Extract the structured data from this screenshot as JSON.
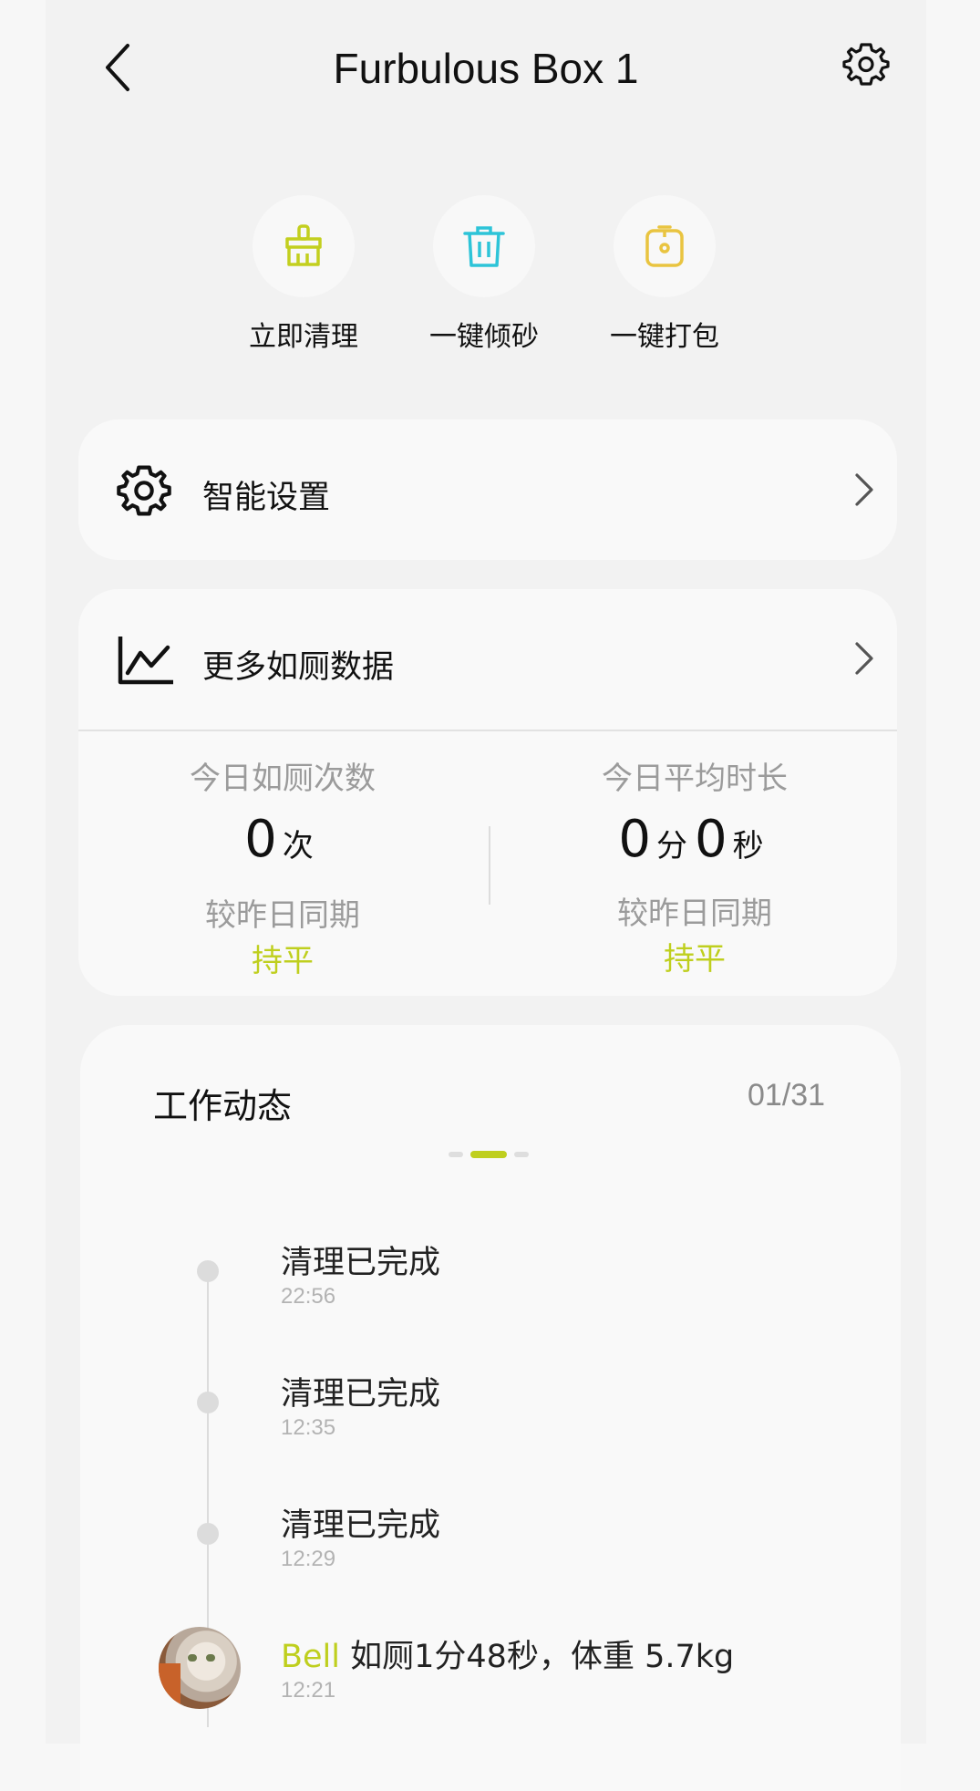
{
  "header": {
    "title": "Furbulous Box 1"
  },
  "quick_actions": [
    {
      "label": "立即清理",
      "icon": "broom-icon",
      "color": "#c3cf1f"
    },
    {
      "label": "一键倾砂",
      "icon": "trash-icon",
      "color": "#2dc4d8"
    },
    {
      "label": "一键打包",
      "icon": "package-icon",
      "color": "#e9c440"
    }
  ],
  "menu": {
    "smart_settings": "智能设置",
    "more_data": "更多如厕数据"
  },
  "stats": {
    "today_count_title": "今日如厕次数",
    "today_count_value": "0",
    "today_count_unit": "次",
    "today_count_compare": "较昨日同期",
    "today_count_trend": "持平",
    "avg_duration_title": "今日平均时长",
    "avg_min_value": "0",
    "avg_min_unit": "分",
    "avg_sec_value": "0",
    "avg_sec_unit": "秒",
    "avg_compare": "较昨日同期",
    "avg_trend": "持平"
  },
  "activity": {
    "title": "工作动态",
    "page": "01/31",
    "events": [
      {
        "text": "清理已完成",
        "time": "22:56"
      },
      {
        "text": "清理已完成",
        "time": "12:35"
      },
      {
        "text": "清理已完成",
        "time": "12:29"
      }
    ],
    "last_event": {
      "cat_name": "Bell",
      "detail": "如厕1分48秒，体重 5.7kg",
      "time": "12:21"
    }
  },
  "colors": {
    "accent": "#bfcf1e",
    "page_bg": "#f2f2f2",
    "card_bg": "#f9f9f9"
  }
}
